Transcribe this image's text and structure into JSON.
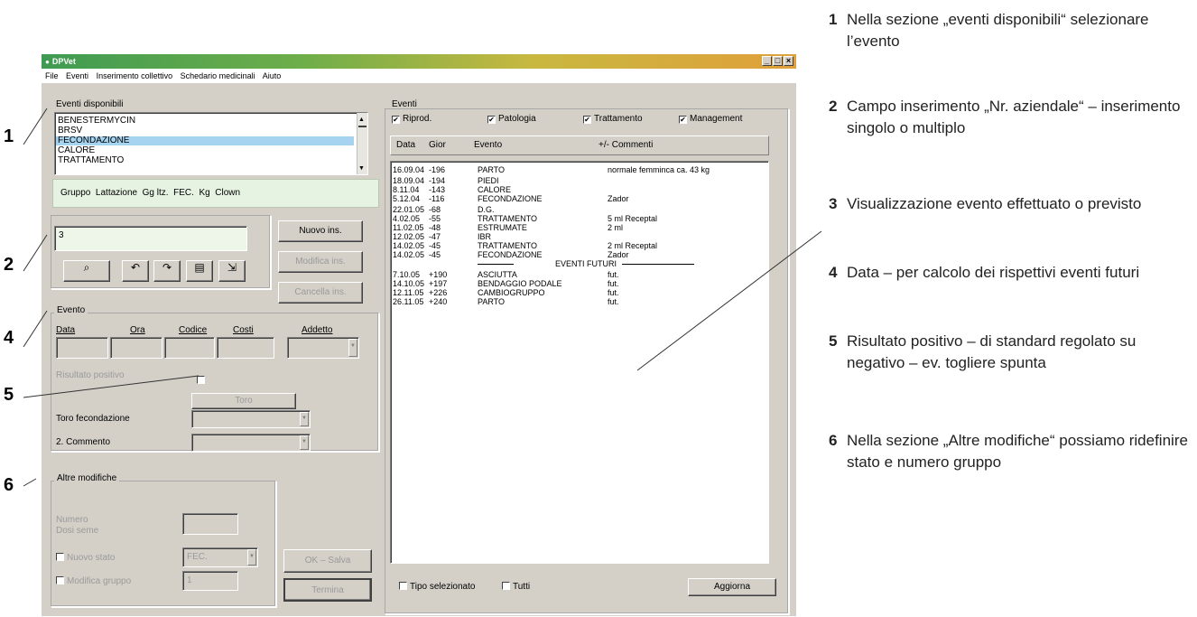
{
  "window": {
    "title": "DPVet",
    "controls": [
      "_",
      "□",
      "×"
    ]
  },
  "menu": [
    "File",
    "Eventi",
    "Inserimento collettivo",
    "Schedario medicinali",
    "Aiuto"
  ],
  "available_events": {
    "title": "Eventi disponibili",
    "items": [
      "BENESTERMYCIN",
      "BRSV",
      "FECONDAZIONE",
      "CALORE",
      "TRATTAMENTO"
    ],
    "selected": "FECONDAZIONE",
    "info_labels": [
      "Gruppo",
      "Lattazione",
      "Gg ltz.",
      "FEC.",
      "Kg",
      "Clown"
    ]
  },
  "animal_input": {
    "value": "3",
    "buttons": {
      "new": "Nuovo ins.",
      "edit": "Modifica ins.",
      "delete": "Cancella ins."
    }
  },
  "evento": {
    "title": "Evento",
    "columns": [
      "Data",
      "Ora",
      "Codice",
      "Costi",
      "Addetto"
    ],
    "positive_result": "Risultato positivo",
    "bull_button": "Toro",
    "bull_fertilization": "Toro fecondazione",
    "comment2": "2. Commento"
  },
  "other_changes": {
    "title": "Altre modifiche",
    "number_label": "Numero",
    "doses_label": "Dosi seme",
    "new_state_label": "Nuovo stato",
    "new_state_value": "FEC.",
    "edit_group_label": "Modifica gruppo",
    "group_value": "1",
    "ok_button": "OK – Salva",
    "end_button": "Termina"
  },
  "events_panel": {
    "title": "Eventi",
    "filters": [
      "Riprod.",
      "Patologia",
      "Trattamento",
      "Management"
    ],
    "headers": [
      "Data",
      "Gior",
      "Evento",
      "+/- Commenti"
    ],
    "rows": [
      {
        "date": "16.09.04",
        "days": "-196",
        "event": "PARTO",
        "comment": "normale femminca ca. 43 kg"
      },
      {
        "date": "18.09.04",
        "days": "-194",
        "event": "PIEDI",
        "comment": ""
      },
      {
        "date": "8.11.04",
        "days": "-143",
        "event": "CALORE",
        "comment": ""
      },
      {
        "date": "5.12.04",
        "days": "-116",
        "event": "FECONDAZIONE",
        "comment": "Zador"
      },
      {
        "date": "22.01.05",
        "days": "-68",
        "event": "D.G.",
        "comment": ""
      },
      {
        "date": "4.02.05",
        "days": "-55",
        "event": "TRATTAMENTO",
        "comment": "5 ml Receptal"
      },
      {
        "date": "11.02.05",
        "days": "-48",
        "event": "ESTRUMATE",
        "comment": "2 ml"
      },
      {
        "date": "12.02.05",
        "days": "-47",
        "event": "IBR",
        "comment": ""
      },
      {
        "date": "14.02.05",
        "days": "-45",
        "event": "TRATTAMENTO",
        "comment": "2 ml Receptal"
      },
      {
        "date": "14.02.05",
        "days": "-45",
        "event": "FECONDAZIONE",
        "comment": "Zador"
      }
    ],
    "future_label": "EVENTI FUTURI",
    "future_rows": [
      {
        "date": "7.10.05",
        "days": "+190",
        "event": "ASCIUTTA",
        "comment": "fut."
      },
      {
        "date": "14.10.05",
        "days": "+197",
        "event": "BENDAGGIO PODALE",
        "comment": "fut."
      },
      {
        "date": "12.11.05",
        "days": "+226",
        "event": "CAMBIOGRUPPO",
        "comment": "fut."
      },
      {
        "date": "26.11.05",
        "days": "+240",
        "event": "PARTO",
        "comment": "fut."
      }
    ],
    "bottom_filters": [
      "Tipo selezionato",
      "Tutti"
    ],
    "refresh_button": "Aggiorna"
  },
  "callouts": [
    "1",
    "2",
    "4",
    "5",
    "6"
  ],
  "explanations": [
    {
      "num": "1",
      "text": "Nella sezione „eventi disponibili“ selezionare l’evento"
    },
    {
      "num": "2",
      "text": "Campo inserimento „Nr. aziendale“ – inserimento singolo o multiplo"
    },
    {
      "num": "3",
      "text": "Visualizzazione evento effettuato o previsto"
    },
    {
      "num": "4",
      "text": "Data – per calcolo dei rispettivi eventi futuri"
    },
    {
      "num": "5",
      "text": "Risultato positivo – di standard regolato su negativo – ev. togliere spunta"
    },
    {
      "num": "6",
      "text": "Nella sezione „Altre modifiche“ possiamo ridefinire stato e numero gruppo"
    }
  ]
}
